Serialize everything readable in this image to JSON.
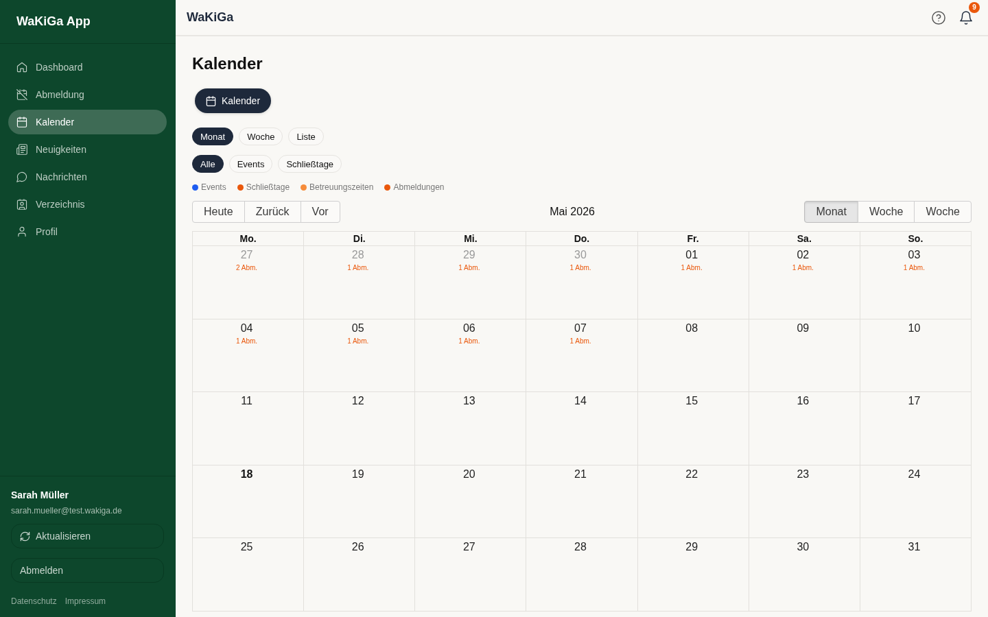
{
  "sidebar": {
    "title": "WaKiGa App",
    "items": [
      {
        "label": "Dashboard",
        "selected": false
      },
      {
        "label": "Abmeldung",
        "selected": false
      },
      {
        "label": "Kalender",
        "selected": true
      },
      {
        "label": "Neuigkeiten",
        "selected": false
      },
      {
        "label": "Nachrichten",
        "selected": false
      },
      {
        "label": "Verzeichnis",
        "selected": false
      },
      {
        "label": "Profil",
        "selected": false
      }
    ],
    "user": {
      "name": "Sarah Müller",
      "email": "sarah.mueller@test.wakiga.de"
    },
    "buttons": [
      "Aktualisieren",
      "Abmelden"
    ],
    "footer_links": [
      "Datenschutz",
      "Impressum"
    ]
  },
  "header": {
    "title": "WaKiGa",
    "notification_count": "9"
  },
  "page": {
    "title": "Kalender",
    "calendar_button": "Kalender",
    "view_tabs": [
      {
        "label": "Monat",
        "selected": true
      },
      {
        "label": "Woche",
        "selected": false
      },
      {
        "label": "Liste",
        "selected": false
      }
    ],
    "filter_tabs": [
      {
        "label": "Alle",
        "selected": true
      },
      {
        "label": "Events",
        "selected": false
      },
      {
        "label": "Schließtage",
        "selected": false
      }
    ],
    "legend": [
      {
        "label": "Events",
        "color": "#1d5cf0"
      },
      {
        "label": "Schließtage",
        "color": "#ea580c"
      },
      {
        "label": "Betreuungszeiten",
        "color": "#f68c3a"
      },
      {
        "label": "Abmeldungen",
        "color": "#ea580c"
      }
    ]
  },
  "calendar": {
    "nav_buttons": [
      "Heute",
      "Zurück",
      "Vor"
    ],
    "period": "Mai 2026",
    "views": [
      {
        "label": "Monat",
        "selected": true
      },
      {
        "label": "Woche",
        "selected": false
      },
      {
        "label": "Woche",
        "selected": false
      }
    ],
    "weekdays": [
      "Mo.",
      "Di.",
      "Mi.",
      "Do.",
      "Fr.",
      "Sa.",
      "So."
    ],
    "weeks": [
      {
        "days": [
          {
            "day": "27",
            "outside": true,
            "today": false,
            "note": "2 Abm."
          },
          {
            "day": "28",
            "outside": true,
            "today": false,
            "note": "1 Abm."
          },
          {
            "day": "29",
            "outside": true,
            "today": false,
            "note": "1 Abm."
          },
          {
            "day": "30",
            "outside": true,
            "today": false,
            "note": "1 Abm."
          },
          {
            "day": "01",
            "outside": false,
            "today": false,
            "note": "1 Abm."
          },
          {
            "day": "02",
            "outside": false,
            "today": false,
            "note": "1 Abm."
          },
          {
            "day": "03",
            "outside": false,
            "today": false,
            "note": "1 Abm."
          }
        ]
      },
      {
        "days": [
          {
            "day": "04",
            "outside": false,
            "today": false,
            "note": "1 Abm."
          },
          {
            "day": "05",
            "outside": false,
            "today": false,
            "note": "1 Abm."
          },
          {
            "day": "06",
            "outside": false,
            "today": false,
            "note": "1 Abm."
          },
          {
            "day": "07",
            "outside": false,
            "today": false,
            "note": "1 Abm."
          },
          {
            "day": "08",
            "outside": false,
            "today": false
          },
          {
            "day": "09",
            "outside": false,
            "today": false
          },
          {
            "day": "10",
            "outside": false,
            "today": false
          }
        ]
      },
      {
        "days": [
          {
            "day": "11",
            "outside": false,
            "today": false
          },
          {
            "day": "12",
            "outside": false,
            "today": false
          },
          {
            "day": "13",
            "outside": false,
            "today": false
          },
          {
            "day": "14",
            "outside": false,
            "today": false
          },
          {
            "day": "15",
            "outside": false,
            "today": false
          },
          {
            "day": "16",
            "outside": false,
            "today": false
          },
          {
            "day": "17",
            "outside": false,
            "today": false
          }
        ]
      },
      {
        "days": [
          {
            "day": "18",
            "outside": false,
            "today": true
          },
          {
            "day": "19",
            "outside": false,
            "today": false
          },
          {
            "day": "20",
            "outside": false,
            "today": false
          },
          {
            "day": "21",
            "outside": false,
            "today": false
          },
          {
            "day": "22",
            "outside": false,
            "today": false
          },
          {
            "day": "23",
            "outside": false,
            "today": false
          },
          {
            "day": "24",
            "outside": false,
            "today": false
          }
        ]
      },
      {
        "days": [
          {
            "day": "25",
            "outside": false,
            "today": false
          },
          {
            "day": "26",
            "outside": false,
            "today": false
          },
          {
            "day": "27",
            "outside": false,
            "today": false
          },
          {
            "day": "28",
            "outside": false,
            "today": false
          },
          {
            "day": "29",
            "outside": false,
            "today": false
          },
          {
            "day": "30",
            "outside": false,
            "today": false
          },
          {
            "day": "31",
            "outside": false,
            "today": false
          }
        ]
      }
    ]
  }
}
